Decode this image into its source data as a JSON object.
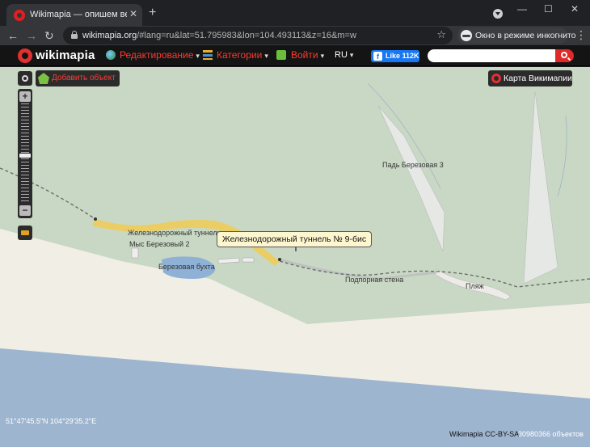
{
  "browser": {
    "tab_title": "Wikimapia — опишем весь мир!",
    "tab_close": "✕",
    "new_tab": "+",
    "url_host": "wikimapia.org",
    "url_rest": "/#lang=ru&lat=51.795983&lon=104.493113&z=16&m=w",
    "incognito_label": "Окно в режиме инкогнито",
    "back": "←",
    "forward": "→",
    "reload": "↻",
    "star": "☆",
    "menu": "⋮",
    "minimize": "—",
    "maximize": "☐",
    "close": "✕"
  },
  "header": {
    "logo_text": "wikimapia",
    "menu": {
      "edit": "Редактирование",
      "categories": "Категории",
      "login": "Войти",
      "lang": "RU"
    },
    "caret": "▾",
    "fb_icon": "f",
    "fb_like": "Like 112K",
    "search_placeholder": ""
  },
  "map": {
    "add_object": "Добавить объект",
    "wikimapia_map": "Карта Викимапии",
    "zoom_in": "+",
    "zoom_out": "−",
    "tooltip": "Железнодорожный туннель № 9-бис",
    "labels": {
      "tunnel": "Железнодорожный туннель",
      "cape": "Мыс Березовый 2",
      "bay": "Березовая бухта",
      "pad": "Падь Березовая 3",
      "wall": "Подпорная стена",
      "beach": "Пляж"
    },
    "coords": "51°47'45.5\"N 104°29'35.2\"E",
    "attribution": "Wikimapia CC-BY-SA",
    "object_count": "30980366 объектов"
  },
  "colors": {
    "land": "#c9d8c4",
    "beach": "#f1eee6",
    "water": "#9eb5d0",
    "road": "#f0cd55",
    "accent": "#ff3b30"
  }
}
